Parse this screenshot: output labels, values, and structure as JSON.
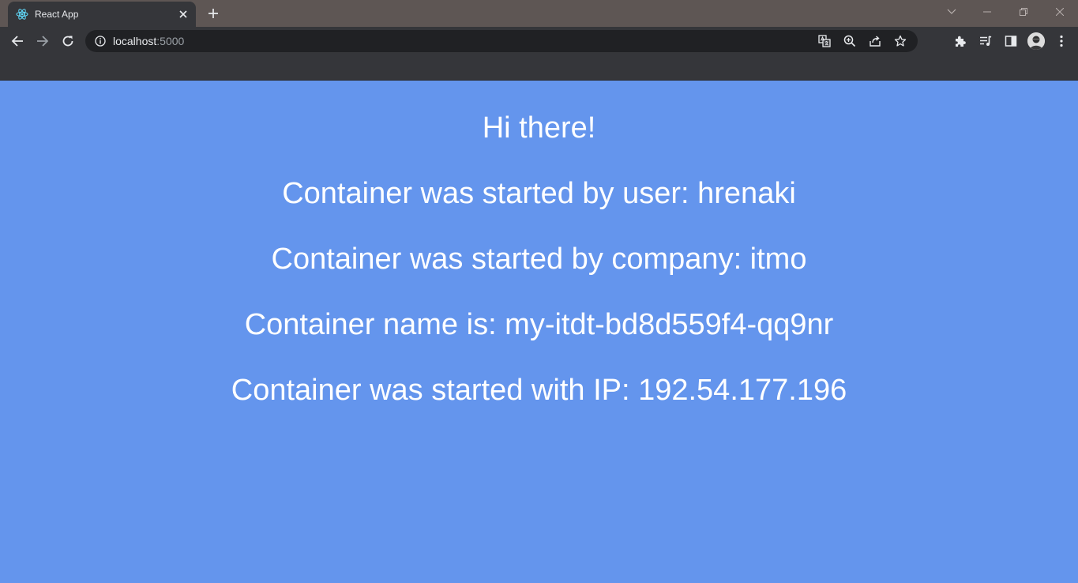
{
  "browser": {
    "tab_title": "React App",
    "url_host": "localhost",
    "url_port": ":5000"
  },
  "icons": {
    "favicon": "react-icon",
    "close": "close-icon",
    "new_tab": "plus-icon",
    "tab_search": "chevron-down-icon",
    "minimize": "minimize-icon",
    "restore": "restore-icon",
    "window_close": "window-close-icon",
    "back": "arrow-left-icon",
    "forward": "arrow-right-icon",
    "reload": "reload-icon",
    "site_info": "info-icon",
    "translate": "translate-icon",
    "zoom": "zoom-icon",
    "share": "share-icon",
    "bookmark": "star-icon",
    "extensions": "puzzle-icon",
    "reading_list": "reading-list-icon",
    "side_panel": "side-panel-icon",
    "profile": "avatar-icon",
    "menu": "kebab-menu-icon"
  },
  "colors": {
    "page_background": "#6495ED",
    "page_text": "#FFFFFF",
    "browser_frame": "#5E5654",
    "toolbar": "#35363A",
    "omnibox": "#202124"
  },
  "page": {
    "greeting": "Hi there!",
    "user_line": "Container was started by user: hrenaki",
    "company_line": "Container was started by company: itmo",
    "name_line": "Container name is: my-itdt-bd8d559f4-qq9nr",
    "ip_line": "Container was started with IP: 192.54.177.196"
  }
}
